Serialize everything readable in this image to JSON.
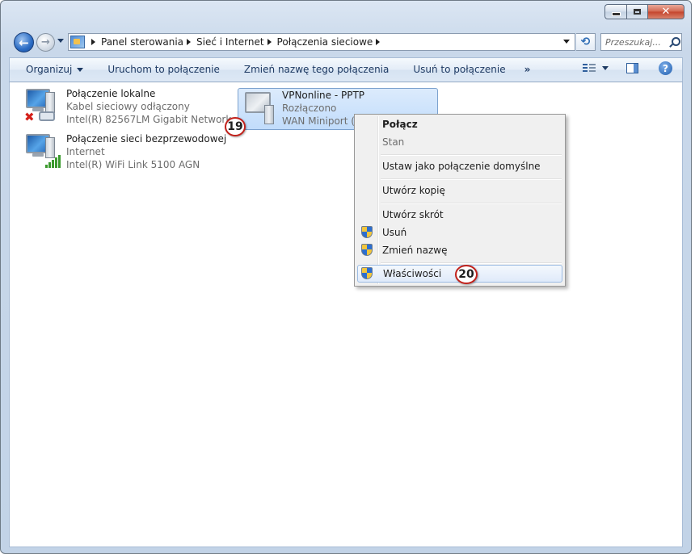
{
  "breadcrumb": [
    "Panel sterowania",
    "Sieć i Internet",
    "Połączenia sieciowe"
  ],
  "search": {
    "placeholder": "Przeszukaj..."
  },
  "toolbar": {
    "organize": "Organizuj",
    "connect": "Uruchom to połączenie",
    "rename": "Zmień nazwę tego połączenia",
    "delete": "Usuń to połączenie",
    "more": "»"
  },
  "connections": [
    {
      "name": "Połączenie lokalne",
      "status": "Kabel sieciowy odłączony",
      "device": "Intel(R) 82567LM Gigabit Network..."
    },
    {
      "name": "Połączenie sieci bezprzewodowej",
      "status": "Internet",
      "device": "Intel(R) WiFi Link 5100 AGN"
    },
    {
      "name": "VPNonline - PPTP",
      "status": "Rozłączono",
      "device": "WAN Miniport (I"
    }
  ],
  "context_menu": {
    "connect": "Połącz",
    "status": "Stan",
    "set_default": "Ustaw jako połączenie domyślne",
    "copy": "Utwórz kopię",
    "shortcut": "Utwórz skrót",
    "delete": "Usuń",
    "rename": "Zmień nazwę",
    "properties": "Właściwości"
  },
  "annotations": {
    "step_a": "19",
    "step_b": "20"
  },
  "colors": {
    "accent": "#2f6db5",
    "badge_border": "#c2211b",
    "selection": "#c1dcfb"
  },
  "icons": [
    "back-arrow-icon",
    "forward-arrow-icon",
    "control-panel-icon",
    "refresh-icon",
    "search-icon",
    "view-options-icon",
    "preview-pane-icon",
    "help-icon",
    "uac-shield-icon"
  ]
}
